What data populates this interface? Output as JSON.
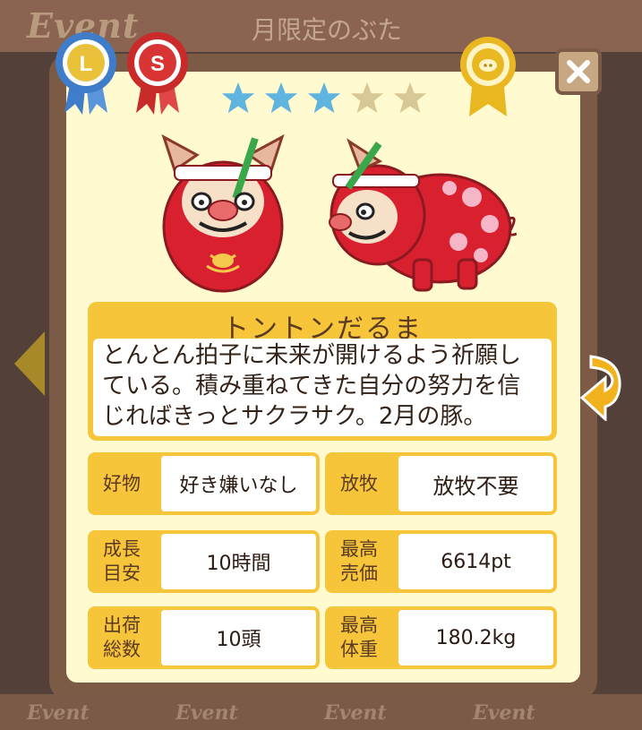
{
  "background": {
    "event_logo": "Event",
    "title": "月限定のぶた",
    "bottom_tabs": [
      "Event",
      "Event",
      "Event",
      "Event"
    ]
  },
  "badges": {
    "left_ribbon": "L",
    "right_ribbon": "S"
  },
  "rating": {
    "filled": 3,
    "total": 5
  },
  "pig": {
    "name": "トントンだるま",
    "description_lines": [
      "とんとん拍子に未来が開けるよう祈願し",
      "ている。積み重ねてきた自分の努力を信",
      "じればきっとサクラサク。2月の豚。"
    ]
  },
  "stats": {
    "favorite": {
      "label": "好物",
      "value": "好き嫌いなし"
    },
    "pasture": {
      "label": "放牧",
      "value": "放牧不要"
    },
    "growth": {
      "label": "成長\n目安",
      "value": "10時間"
    },
    "max_price": {
      "label": "最高\n売価",
      "value": "6614pt"
    },
    "shipped": {
      "label": "出荷\n総数",
      "value": "10頭"
    },
    "max_weight": {
      "label": "最高\n体重",
      "value": "180.2kg"
    }
  },
  "colors": {
    "frame": "#7b5a46",
    "panel": "#fffad0",
    "accent": "#f6c53a",
    "star_filled": "#5fb5e0",
    "star_empty": "#d8c896"
  }
}
